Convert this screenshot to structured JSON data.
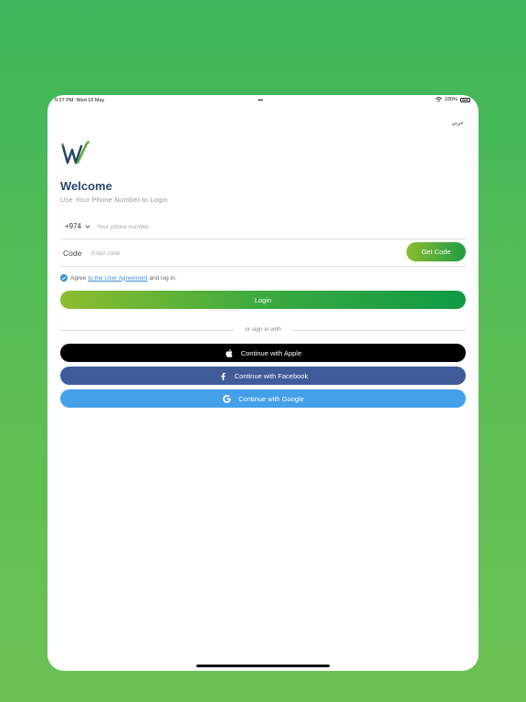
{
  "status_bar": {
    "time": "5:27 PM",
    "date": "Wed 15 May",
    "dots": "•••",
    "battery": "100%"
  },
  "language_link": "عربي",
  "welcome": {
    "title": "Welcome",
    "subtitle": "Use Your Phone Number to Login"
  },
  "phone": {
    "country_code": "+974",
    "placeholder": "Your phone number",
    "value": ""
  },
  "code": {
    "label": "Code",
    "placeholder": "Enter code",
    "value": "",
    "get_code_label": "Get Code"
  },
  "agreement": {
    "prefix": "Agree",
    "link": "to the User Agreement",
    "suffix": "and log in.",
    "checked": true
  },
  "login_label": "Login",
  "divider_text": "or sign in with",
  "social": {
    "apple_label": "Continue with Apple",
    "facebook_label": "Continue with Facebook",
    "google_label": "Continue with Google"
  },
  "colors": {
    "background": "#4cbb57",
    "title": "#2a4a6d",
    "accent_start": "#8dbd2f",
    "accent_end": "#0e9a45",
    "apple": "#000000",
    "facebook": "#3f5b9a",
    "google": "#45a0ea",
    "link": "#3c8fd8"
  },
  "icons": [
    "wifi-icon",
    "battery-icon",
    "logo-icon",
    "chevron-down-icon",
    "check-icon",
    "apple-icon",
    "facebook-icon",
    "google-icon"
  ]
}
